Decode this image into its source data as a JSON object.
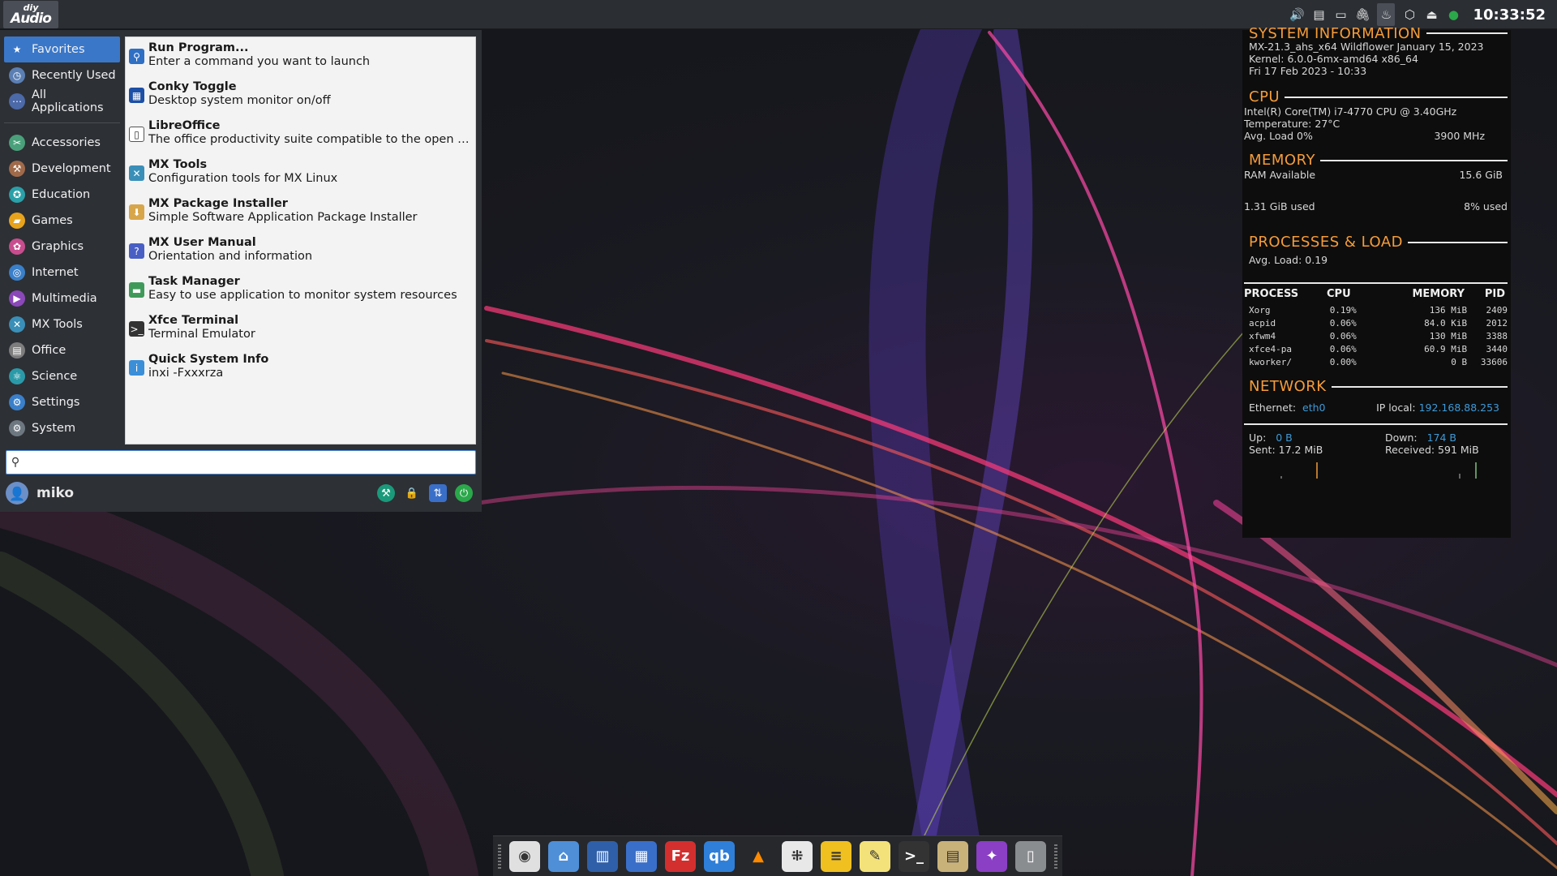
{
  "top_panel": {
    "logo": {
      "line1": "diy",
      "line2": "Audio"
    },
    "clock": "10:33:52",
    "tray": [
      "volume-icon",
      "clipboard-icon",
      "display-icon",
      "paperclip-icon",
      "flame-icon",
      "package-icon",
      "eject-icon",
      "update-icon"
    ]
  },
  "menu": {
    "categories": [
      {
        "label": "Favorites",
        "icon": "star-icon",
        "color": "#3a77c9"
      },
      {
        "label": "Recently Used",
        "icon": "clock-icon",
        "color": "#5b7fb3"
      },
      {
        "label": "All Applications",
        "icon": "grid-icon",
        "color": "#4c69a8"
      },
      {
        "label": "Accessories",
        "icon": "accessories-icon",
        "color": "#4aa07a"
      },
      {
        "label": "Development",
        "icon": "development-icon",
        "color": "#a06a4a"
      },
      {
        "label": "Education",
        "icon": "education-icon",
        "color": "#2aa0a8"
      },
      {
        "label": "Games",
        "icon": "gamepad-icon",
        "color": "#e8a31c"
      },
      {
        "label": "Graphics",
        "icon": "graphics-icon",
        "color": "#c84d8e"
      },
      {
        "label": "Internet",
        "icon": "globe-icon",
        "color": "#3a7fc9"
      },
      {
        "label": "Multimedia",
        "icon": "multimedia-icon",
        "color": "#8a48b8"
      },
      {
        "label": "MX Tools",
        "icon": "mx-tools-icon",
        "color": "#3a8fb8"
      },
      {
        "label": "Office",
        "icon": "office-icon",
        "color": "#7d7d7d"
      },
      {
        "label": "Science",
        "icon": "science-icon",
        "color": "#2a9aa8"
      },
      {
        "label": "Settings",
        "icon": "settings-icon",
        "color": "#3a7fc9"
      },
      {
        "label": "System",
        "icon": "system-icon",
        "color": "#6d7780"
      }
    ],
    "apps": [
      {
        "name": "Run Program...",
        "desc": "Enter a command you want to launch",
        "icon": "run-icon",
        "color": "#2f6fc4"
      },
      {
        "name": "Conky Toggle",
        "desc": "Desktop system monitor on/off",
        "icon": "conky-icon",
        "color": "#1c4fa6"
      },
      {
        "name": "LibreOffice",
        "desc": "The office productivity suite compatible to the open and ...",
        "icon": "libreoffice-icon",
        "color": "#ffffff"
      },
      {
        "name": "MX Tools",
        "desc": "Configuration tools for MX Linux",
        "icon": "mx-tools-icon",
        "color": "#3a8fb8"
      },
      {
        "name": "MX Package Installer",
        "desc": "Simple Software Application Package Installer",
        "icon": "package-installer-icon",
        "color": "#d8a64a"
      },
      {
        "name": "MX User Manual",
        "desc": "Orientation and information",
        "icon": "manual-icon",
        "color": "#4a5fc4"
      },
      {
        "name": "Task Manager",
        "desc": "Easy to use application to monitor system resources",
        "icon": "task-manager-icon",
        "color": "#3f9a5a"
      },
      {
        "name": "Xfce Terminal",
        "desc": "Terminal Emulator",
        "icon": "terminal-icon",
        "color": "#333333"
      },
      {
        "name": "Quick System Info",
        "desc": "inxi -Fxxxrza",
        "icon": "system-info-icon",
        "color": "#3a8fd8"
      }
    ],
    "search": {
      "value": "",
      "placeholder": ""
    },
    "user": {
      "name": "miko"
    },
    "actions": [
      {
        "icon": "wrench-icon",
        "color": "#1a9a7a"
      },
      {
        "icon": "lock-icon",
        "color": "#2d3035"
      },
      {
        "icon": "switch-user-icon",
        "color": "#3a6fc9"
      },
      {
        "icon": "logout-icon",
        "color": "#2aa84a"
      }
    ]
  },
  "conky": {
    "sysinfo": {
      "title": "SYSTEM INFORMATION",
      "os": "MX-21.3_ahs_x64 Wildflower January 15, 2023",
      "kernel": "Kernel: 6.0.0-6mx-amd64 x86_64",
      "date": "Fri 17 Feb 2023 - 10:33"
    },
    "cpu": {
      "title": "CPU",
      "model": "Intel(R) Core(TM) i7-4770 CPU @ 3.40GHz",
      "temperature": "Temperature:  27°C",
      "load": "Avg. Load 0%",
      "freq": "3900 MHz"
    },
    "memory": {
      "title": "MEMORY",
      "available_label": "RAM Available",
      "available": "15.6 GiB",
      "used": "1.31 GiB used",
      "percent": "8% used"
    },
    "processes": {
      "title": "PROCESSES & LOAD",
      "load": "Avg. Load: 0.19",
      "headers": [
        "PROCESS",
        "CPU",
        "MEMORY",
        "PID"
      ],
      "rows": [
        [
          "Xorg",
          "0.19%",
          "136 MiB",
          "2409"
        ],
        [
          "acpid",
          "0.06%",
          "84.0 KiB",
          "2012"
        ],
        [
          "xfwm4",
          "0.06%",
          "130 MiB",
          "3388"
        ],
        [
          "xfce4-pa",
          "0.06%",
          "60.9 MiB",
          "3440"
        ],
        [
          "kworker/",
          "0.00%",
          "0 B",
          "33606"
        ]
      ]
    },
    "network": {
      "title": "NETWORK",
      "ethernet_label": "Ethernet:",
      "ethernet": "eth0",
      "ip_label": "IP local:",
      "ip": "192.168.88.253",
      "up_label": "Up:",
      "up": "0 B",
      "down_label": "Down:",
      "down": "174 B",
      "sent": "Sent: 17.2 MiB",
      "received": "Received: 591 MiB"
    }
  },
  "dock": [
    {
      "icon": "chrome-icon",
      "color": "#e0e0e0",
      "glyph": "◉"
    },
    {
      "icon": "file-manager-icon",
      "color": "#4f8fd8",
      "glyph": "⌂"
    },
    {
      "icon": "notebook-icon",
      "color": "#2f5fa8",
      "glyph": "▥"
    },
    {
      "icon": "calculator-icon",
      "color": "#3a6fc9",
      "glyph": "▦"
    },
    {
      "icon": "filezilla-icon",
      "color": "#d32f2f",
      "glyph": "Fz"
    },
    {
      "icon": "qbittorrent-icon",
      "color": "#2f7fd8",
      "glyph": "qb"
    },
    {
      "icon": "vlc-icon",
      "color": "#26282c",
      "glyph": "▲"
    },
    {
      "icon": "tidal-icon",
      "color": "#e8e8e8",
      "glyph": "⁜"
    },
    {
      "icon": "notes-icon",
      "color": "#f0c020",
      "glyph": "≡"
    },
    {
      "icon": "text-editor-icon",
      "color": "#f3e27a",
      "glyph": "✎"
    },
    {
      "icon": "terminal-icon",
      "color": "#333333",
      "glyph": ">_"
    },
    {
      "icon": "archive-icon",
      "color": "#c9b27a",
      "glyph": "▤"
    },
    {
      "icon": "firefox-icon",
      "color": "#8a3fc4",
      "glyph": "✦"
    },
    {
      "icon": "trash-icon",
      "color": "#8a8d90",
      "glyph": "▯"
    }
  ]
}
